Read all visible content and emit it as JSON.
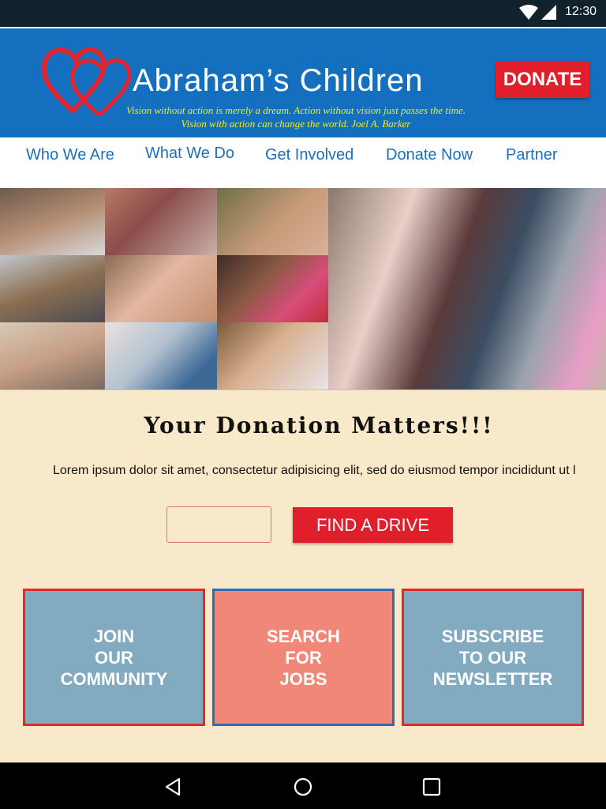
{
  "status_bar": {
    "time": "12:30"
  },
  "header": {
    "brand": "Abraham’s Children",
    "quote_line1": "Vision without action is merely a dream. Action without vision just passes the time.",
    "quote_line2": "Vision with action can change the world.     Joel A. Barker",
    "donate_label": "DONATE"
  },
  "nav": {
    "items": [
      {
        "label": "Who We Are"
      },
      {
        "label": "What We Do"
      },
      {
        "label": "Get Involved"
      },
      {
        "label": "Donate Now"
      },
      {
        "label": "Partner"
      }
    ]
  },
  "main": {
    "heading": "Your Donation Matters!!!",
    "body": "Lorem ipsum dolor sit amet, consectetur adipisicing elit, sed do eiusmod tempor incididunt ut l",
    "drive_input_value": "",
    "find_drive_label": "FIND A DRIVE",
    "tiles": [
      {
        "label": "JOIN\nOUR\nCOMMUNITY",
        "bg": "#82abc2",
        "border": "#e02a2f"
      },
      {
        "label": "SEARCH\nFOR\nJOBS",
        "bg": "#f08778",
        "border": "#2a6db5"
      },
      {
        "label": "SUBSCRIBE\nTO OUR\nNEWSLETTER",
        "bg": "#82abc2",
        "border": "#e02a2f"
      }
    ]
  },
  "colors": {
    "header_blue": "#1470bf",
    "accent_red": "#e11f2b",
    "quote_yellow": "#f4ea23",
    "nav_blue": "#1e6fb8",
    "content_bg": "#f7e9c9"
  },
  "icons": {
    "status": [
      "wifi-icon",
      "signal-icon"
    ],
    "logo": "hearts-logo-icon",
    "system_nav": [
      "back-icon",
      "home-icon",
      "recents-icon"
    ]
  }
}
